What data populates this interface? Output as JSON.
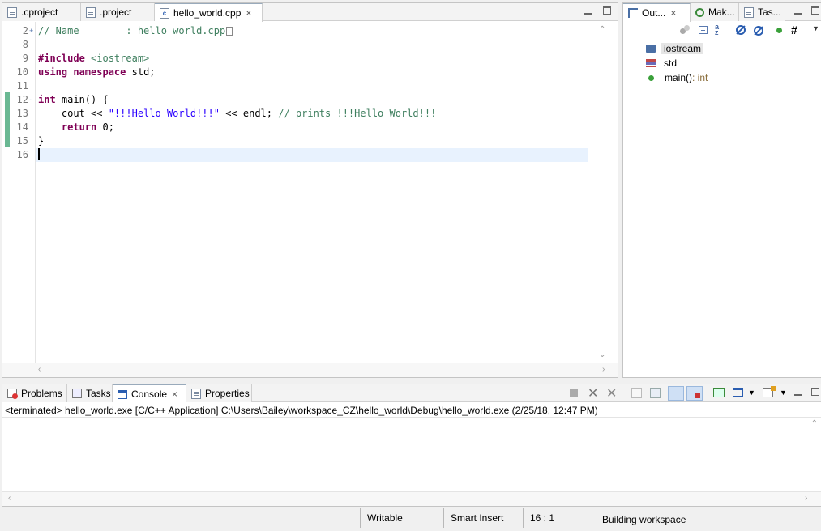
{
  "editor_tabs": [
    {
      "label": ".cproject",
      "icon": "file-icon"
    },
    {
      "label": ".project",
      "icon": "file-icon"
    },
    {
      "label": "hello_world.cpp",
      "icon": "cpp-file-icon",
      "active": true,
      "close": "×"
    }
  ],
  "editor": {
    "lines": [
      {
        "num": "2",
        "fold": "+",
        "parts": [
          [
            "cmt",
            "// Name        : hello_world.cpp"
          ]
        ]
      },
      {
        "num": "8",
        "parts": []
      },
      {
        "num": "9",
        "parts": [
          [
            "kw",
            "#include"
          ],
          [
            "",
            " "
          ],
          [
            "inc",
            "<iostream>"
          ]
        ]
      },
      {
        "num": "10",
        "parts": [
          [
            "kw",
            "using"
          ],
          [
            "",
            " "
          ],
          [
            "kw",
            "namespace"
          ],
          [
            "",
            " std;"
          ]
        ]
      },
      {
        "num": "11",
        "parts": []
      },
      {
        "num": "12",
        "fold": "-",
        "parts": [
          [
            "kw",
            "int"
          ],
          [
            "",
            " main() {"
          ]
        ]
      },
      {
        "num": "13",
        "parts": [
          [
            "",
            "    cout << "
          ],
          [
            "str",
            "\"!!!Hello World!!!\""
          ],
          [
            "",
            " << endl; "
          ],
          [
            "cmt",
            "// prints !!!Hello World!!!"
          ]
        ]
      },
      {
        "num": "14",
        "parts": [
          [
            "",
            "    "
          ],
          [
            "kw",
            "return"
          ],
          [
            "",
            " 0;"
          ]
        ]
      },
      {
        "num": "15",
        "parts": [
          [
            "",
            "}"
          ]
        ]
      },
      {
        "num": "16",
        "parts": [],
        "current": true
      }
    ]
  },
  "outline_tabs": [
    {
      "label": "Out...",
      "icon": "outline-icon",
      "active": true,
      "close": "×"
    },
    {
      "label": "Mak...",
      "icon": "make-target-icon"
    },
    {
      "label": "Tas...",
      "icon": "task-list-icon"
    }
  ],
  "outline": {
    "items": [
      {
        "label": "iostream",
        "icon": "include-icon",
        "selected": true
      },
      {
        "label": "std",
        "icon": "namespace-icon"
      },
      {
        "label": "main()",
        "type": " : int",
        "icon": "function-icon"
      }
    ]
  },
  "bottom_tabs": [
    {
      "label": "Problems",
      "icon": "problems-icon"
    },
    {
      "label": "Tasks",
      "icon": "tasks-icon"
    },
    {
      "label": "Console",
      "icon": "console-icon",
      "active": true,
      "close": "×"
    },
    {
      "label": "Properties",
      "icon": "properties-icon"
    }
  ],
  "console": {
    "header": "<terminated> hello_world.exe [C/C++ Application] C:\\Users\\Bailey\\workspace_CZ\\hello_world\\Debug\\hello_world.exe (2/25/18, 12:47 PM)"
  },
  "status": {
    "writable": "Writable",
    "insert_mode": "Smart Insert",
    "position": "16 : 1",
    "task": "Building workspace"
  },
  "colors": {
    "keyword": "#7f0055",
    "string": "#2a00ff",
    "comment": "#3f7f5f",
    "change_bar": "#6ab893",
    "current_line": "#e8f2fe"
  }
}
